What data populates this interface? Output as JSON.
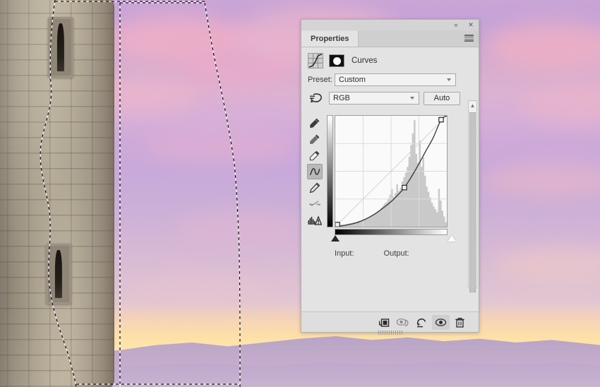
{
  "app": {
    "panel_title": "Properties",
    "adjustment_name": "Curves"
  },
  "titlebar": {
    "collapse_icon": "«",
    "close_icon": "✕"
  },
  "preset": {
    "label": "Preset:",
    "value": "Custom"
  },
  "channel": {
    "value": "RGB",
    "auto_label": "Auto"
  },
  "graph_labels": {
    "input": "Input:",
    "output": "Output:"
  },
  "tools": [
    {
      "name": "sample-in-image-icon",
      "label": "Targeted adjustment tool"
    },
    {
      "name": "black-point-eyedropper-icon",
      "label": "Sample in image to set black point"
    },
    {
      "name": "gray-point-eyedropper-icon",
      "label": "Sample in image to set gray point"
    },
    {
      "name": "white-point-eyedropper-icon",
      "label": "Sample in image to set white point"
    },
    {
      "name": "curve-point-tool-icon",
      "label": "Edit points to modify the curve",
      "active": true
    },
    {
      "name": "pencil-draw-curve-icon",
      "label": "Draw to modify the curve"
    },
    {
      "name": "smooth-curve-values-icon",
      "label": "Smooth the curve values"
    },
    {
      "name": "curves-display-options-icon",
      "label": "Curves display options"
    }
  ],
  "footer_buttons": [
    {
      "name": "clip-to-layer-button",
      "label": "Clip to layer"
    },
    {
      "name": "view-previous-state-button",
      "label": "View previous state"
    },
    {
      "name": "reset-button",
      "label": "Reset to adjustment defaults"
    },
    {
      "name": "toggle-visibility-button",
      "label": "Toggle layer visibility",
      "active": true
    },
    {
      "name": "delete-button",
      "label": "Delete this adjustment layer"
    }
  ],
  "chart_data": {
    "type": "line",
    "title": "Curves",
    "xlabel": "Input",
    "ylabel": "Output",
    "xlim": [
      0,
      255
    ],
    "ylim": [
      0,
      255
    ],
    "grid": true,
    "grid_divisions": 4,
    "baseline": {
      "name": "identity-diagonal",
      "points": [
        [
          0,
          0
        ],
        [
          255,
          255
        ]
      ]
    },
    "series": [
      {
        "name": "rgb-curve",
        "channel": "RGB",
        "control_points": [
          [
            0,
            0
          ],
          [
            158,
            90
          ],
          [
            242,
            246
          ]
        ],
        "curve_points": [
          [
            0,
            0
          ],
          [
            16,
            2
          ],
          [
            32,
            5
          ],
          [
            48,
            9
          ],
          [
            64,
            15
          ],
          [
            80,
            23
          ],
          [
            96,
            33
          ],
          [
            112,
            45
          ],
          [
            128,
            58
          ],
          [
            144,
            74
          ],
          [
            158,
            90
          ],
          [
            176,
            118
          ],
          [
            192,
            146
          ],
          [
            208,
            176
          ],
          [
            224,
            205
          ],
          [
            242,
            246
          ],
          [
            255,
            255
          ]
        ]
      }
    ],
    "histogram": {
      "name": "image-histogram",
      "bins": 64,
      "values": [
        2,
        2,
        2,
        3,
        3,
        3,
        4,
        4,
        5,
        5,
        6,
        6,
        7,
        8,
        8,
        9,
        10,
        11,
        12,
        13,
        14,
        16,
        17,
        19,
        21,
        23,
        26,
        29,
        32,
        34,
        38,
        44,
        52,
        41,
        46,
        58,
        49,
        53,
        62,
        68,
        74,
        82,
        96,
        112,
        128,
        146,
        100,
        88,
        118,
        82,
        95,
        70,
        55,
        48,
        40,
        33,
        28,
        24,
        20,
        52,
        36,
        22,
        14,
        6
      ]
    },
    "black_point_slider": 0,
    "white_point_slider": 255
  }
}
